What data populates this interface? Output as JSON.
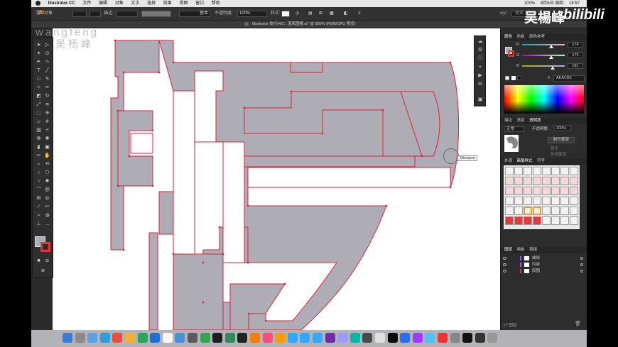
{
  "menubar": {
    "app_name": "Illustrator CC",
    "items": [
      "文件",
      "编辑",
      "对象",
      "文字",
      "选择",
      "效果",
      "视图",
      "窗口",
      "帮助"
    ],
    "right": [
      "100%",
      "8月6日 周四",
      "18:57"
    ]
  },
  "control_bar": {
    "group_label": "混合对象",
    "stroke_label": "描边:",
    "stroke_style": "基本",
    "opacity_label": "不透明度:",
    "opacity_value": "100%",
    "style_label": "样式:"
  },
  "document_tab": {
    "title": "Illustrator 技巧#60：混风图案.ai* @ 300% (RGB/GPU 预览)"
  },
  "watermark": {
    "line1": "wangfeng",
    "line2": "吴杨峰"
  },
  "search": {
    "placeholder": "搜索 Adobe Stock",
    "user": "wyf"
  },
  "overlay_brand": {
    "name": "吴楊峰",
    "site": "bilibili"
  },
  "tooltip": {
    "text": "Tolerance"
  },
  "color_panel": {
    "tabs": [
      "颜色",
      "色板",
      "颜色参考"
    ],
    "channels": [
      {
        "label": "R",
        "value": "174",
        "position": 0.682
      },
      {
        "label": "G",
        "value": "172",
        "position": 0.675
      },
      {
        "label": "B",
        "value": "181",
        "position": 0.71
      }
    ],
    "hex_label": "#",
    "hex_value": "AEACB5"
  },
  "transparency_panel": {
    "tabs": [
      "描边",
      "渐变",
      "透明度"
    ],
    "mode": "正常",
    "opacity_label": "不透明度:",
    "opacity_value": "100%",
    "mask_button": "制作蒙版",
    "clip_label": "剪切",
    "invert_label": "反相蒙版"
  },
  "swatch_panel": {
    "tabs": [
      "外观",
      "画笔样式",
      "符号"
    ]
  },
  "layers_panel": {
    "tabs": [
      "图层",
      "画板",
      "链接"
    ],
    "layers": [
      {
        "name": "曲线",
        "color": "#4f7cff"
      },
      {
        "name": "内容",
        "color": "#b44bff"
      },
      {
        "name": "底图",
        "color": "#e33b3b"
      }
    ],
    "footer": "3个图层"
  },
  "colors": {
    "fill": "#aeacb5",
    "path": "#e01e3c",
    "accent": "#f39a2b"
  },
  "tools": [
    "selection",
    "direct-selection",
    "magic-wand",
    "lasso",
    "pen",
    "curvature",
    "type",
    "line",
    "rectangle",
    "paintbrush",
    "shaper",
    "pencil",
    "eraser",
    "rotate",
    "scale",
    "width",
    "free-transform",
    "shape-builder",
    "perspective",
    "mesh",
    "gradient",
    "eyedropper",
    "blend",
    "symbol-sprayer",
    "column-graph",
    "artboard",
    "slice",
    "hand",
    "zoom"
  ]
}
